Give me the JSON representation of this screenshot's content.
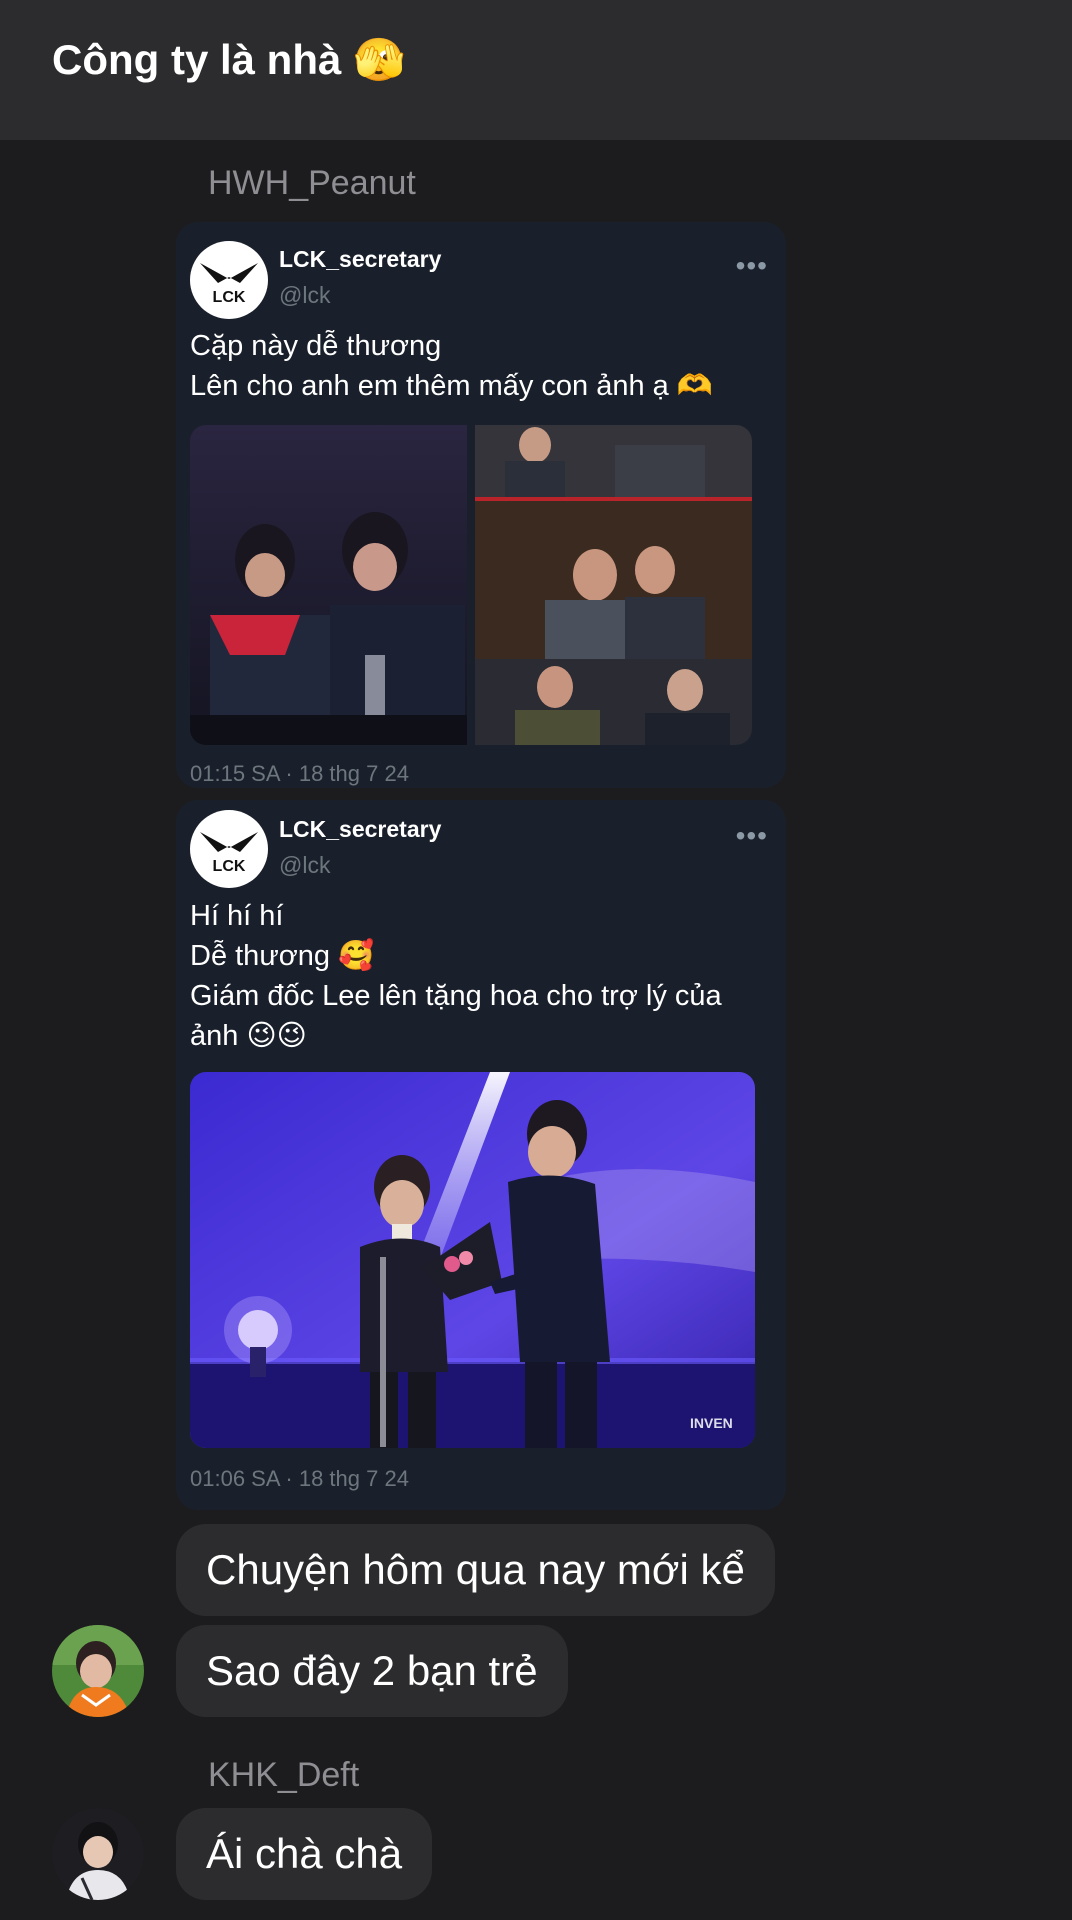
{
  "header": {
    "title": "Công ty là nhà 🫣"
  },
  "messages": {
    "sender1": "HWH_Peanut",
    "tweet1": {
      "name": "LCK_secretary",
      "handle": "@lck",
      "line1": "Cặp này dễ thương",
      "line2": "Lên cho anh em thêm mấy con ảnh ạ 🫶",
      "time": "01:15 SA · 18 thg 7 24",
      "logo_text": "LCK"
    },
    "tweet2": {
      "name": "LCK_secretary",
      "handle": "@lck",
      "line1": "Hí hí hí",
      "line2": "Dễ thương 🥰",
      "line3": "Giám đốc Lee lên tặng hoa cho trợ lý của",
      "line4": "ảnh 😉😉",
      "time": "01:06 SA · 18 thg 7 24",
      "logo_text": "LCK",
      "watermark": "INVEN"
    },
    "bubble1": "Chuyện hôm qua nay mới kể",
    "bubble2": "Sao đây 2 bạn trẻ",
    "sender2": "KHK_Deft",
    "bubble3": "Ái chà chà",
    "more_icon": "ellipsis-icon"
  },
  "colors": {
    "background": "#1c1c1e",
    "header": "#2c2c2e",
    "bubble": "#2c2c2e",
    "tweet_card": "#1a202b",
    "muted_text": "#8e8e93"
  }
}
